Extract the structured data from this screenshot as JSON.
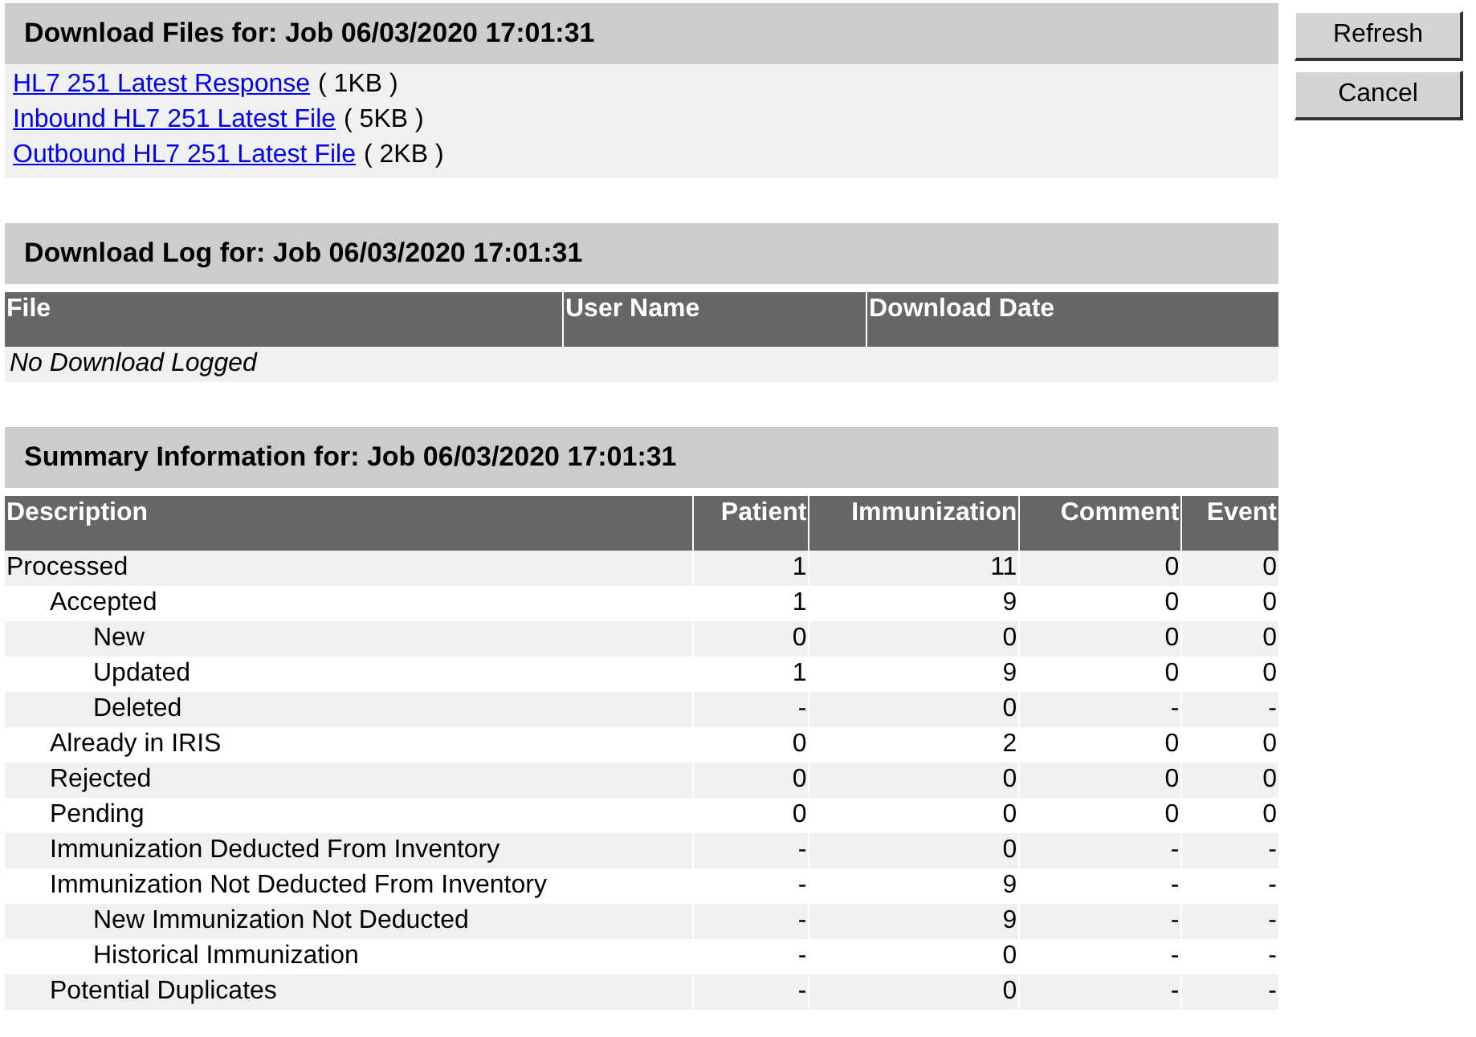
{
  "files": {
    "title": "Download Files for: Job 06/03/2020 17:01:31",
    "items": [
      {
        "link": "HL7 251 Latest Response",
        "size": "( 1KB )"
      },
      {
        "link": "Inbound HL7 251 Latest File",
        "size": "( 5KB )"
      },
      {
        "link": "Outbound HL7 251 Latest File",
        "size": "( 2KB )"
      }
    ]
  },
  "buttons": [
    "Refresh",
    "Cancel"
  ],
  "log": {
    "title": "Download Log for: Job 06/03/2020 17:01:31",
    "columns": [
      "File",
      "User Name",
      "Download Date"
    ],
    "empty": "No Download Logged"
  },
  "summary": {
    "title": "Summary Information for: Job 06/03/2020 17:01:31",
    "columns": [
      "Description",
      "Patient",
      "Immunization",
      "Comment",
      "Event"
    ],
    "rows": [
      {
        "label": "Processed",
        "values": [
          "1",
          "11",
          "0",
          "0"
        ],
        "children": [
          {
            "label": "Accepted",
            "values": [
              "1",
              "9",
              "0",
              "0"
            ],
            "children": [
              {
                "label": "New",
                "values": [
                  "0",
                  "0",
                  "0",
                  "0"
                ]
              },
              {
                "label": "Updated",
                "values": [
                  "1",
                  "9",
                  "0",
                  "0"
                ]
              },
              {
                "label": "Deleted",
                "values": [
                  "-",
                  "0",
                  "-",
                  "-"
                ]
              }
            ]
          },
          {
            "label": "Already in IRIS",
            "values": [
              "0",
              "2",
              "0",
              "0"
            ]
          },
          {
            "label": "Rejected",
            "values": [
              "0",
              "0",
              "0",
              "0"
            ]
          },
          {
            "label": "Pending",
            "values": [
              "0",
              "0",
              "0",
              "0"
            ]
          },
          {
            "label": "Immunization Deducted From Inventory",
            "values": [
              "-",
              "0",
              "-",
              "-"
            ]
          },
          {
            "label": "Immunization Not Deducted From Inventory",
            "values": [
              "-",
              "9",
              "-",
              "-"
            ],
            "children": [
              {
                "label": "New Immunization Not Deducted",
                "values": [
                  "-",
                  "9",
                  "-",
                  "-"
                ]
              },
              {
                "label": "Historical Immunization",
                "values": [
                  "-",
                  "0",
                  "-",
                  "-"
                ]
              }
            ]
          },
          {
            "label": "Potential Duplicates",
            "values": [
              "-",
              "0",
              "-",
              "-"
            ]
          }
        ]
      }
    ]
  }
}
